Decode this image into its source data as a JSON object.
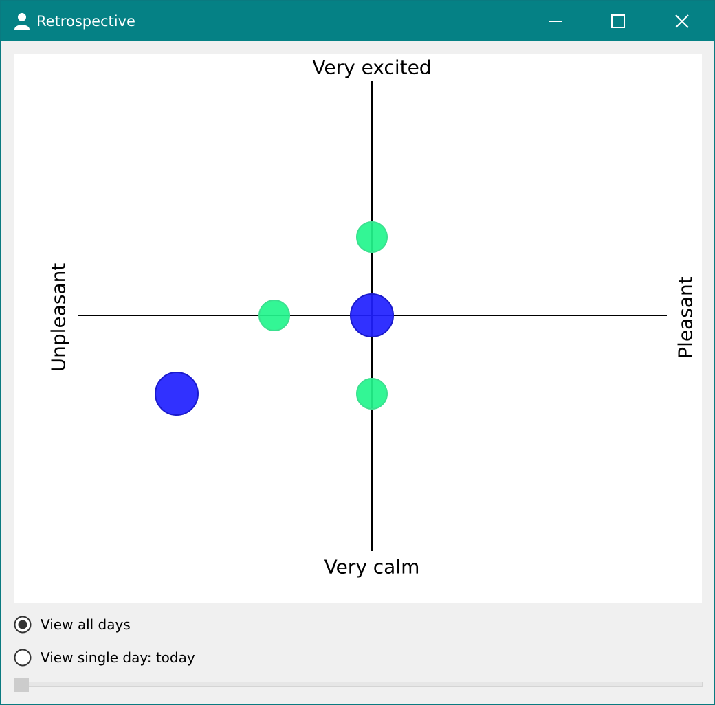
{
  "window": {
    "title": "Retrospective",
    "icon": "person-icon",
    "controls": [
      "minimize-icon",
      "maximize-icon",
      "close-icon"
    ],
    "titlebar_color": "#058185"
  },
  "chart_data": {
    "type": "scatter",
    "x_axis": {
      "negative_label": "Unpleasant",
      "positive_label": "Pleasant"
    },
    "y_axis": {
      "negative_label": "Very calm",
      "positive_label": "Very excited"
    },
    "xlim": [
      -3,
      3
    ],
    "ylim": [
      -3,
      3
    ],
    "grid": false,
    "points": [
      {
        "x": 0,
        "y": 1,
        "size": "small",
        "color": "#22f58c"
      },
      {
        "x": -1,
        "y": 0,
        "size": "small",
        "color": "#22f58c"
      },
      {
        "x": 0,
        "y": -1,
        "size": "small",
        "color": "#22f58c"
      },
      {
        "x": 0,
        "y": 0,
        "size": "large",
        "color": "#2020ff"
      },
      {
        "x": -2,
        "y": -1,
        "size": "large",
        "color": "#2020ff"
      }
    ]
  },
  "view_options": {
    "selected": "all",
    "all_label": "View all days",
    "single_label": "View single day: today"
  },
  "slider": {
    "value": 0
  }
}
